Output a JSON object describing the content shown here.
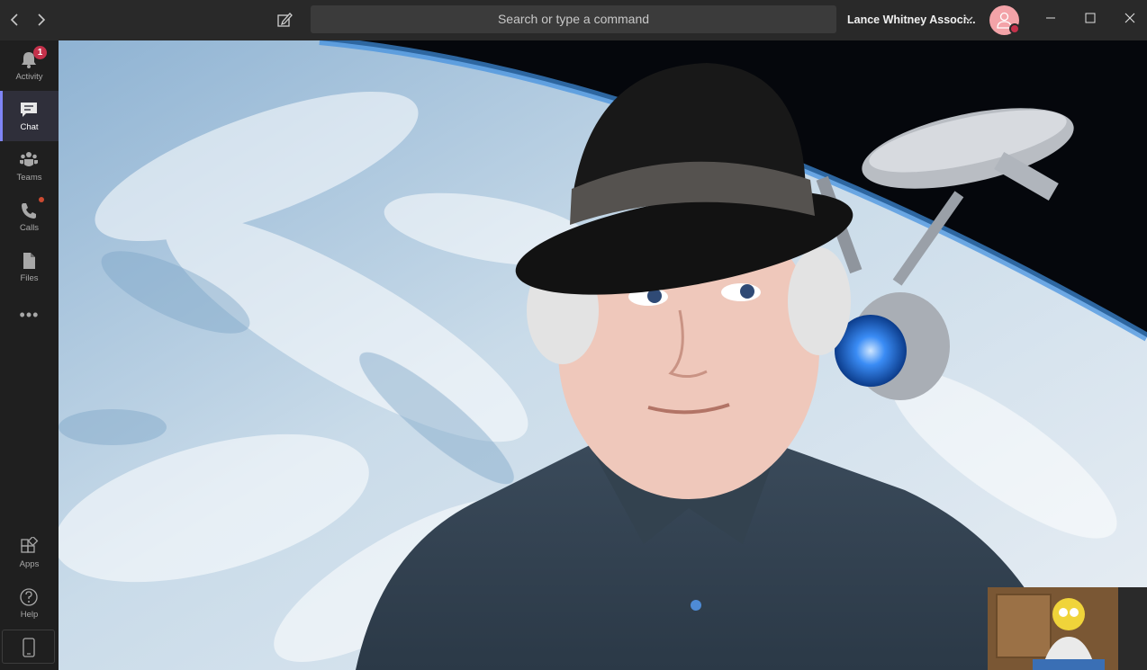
{
  "titlebar": {
    "search_placeholder": "Search or type a command",
    "org_name": "Lance Whitney Associ...",
    "back_icon": "chevron-left-icon",
    "forward_icon": "chevron-right-icon",
    "compose_icon": "compose-icon",
    "minimize_icon": "minimize-icon",
    "maximize_icon": "maximize-icon",
    "close_icon": "close-icon"
  },
  "rail": {
    "items": [
      {
        "label": "Activity",
        "icon": "bell-icon",
        "badge": "1"
      },
      {
        "label": "Chat",
        "icon": "chat-icon",
        "active": true
      },
      {
        "label": "Teams",
        "icon": "teams-icon"
      },
      {
        "label": "Calls",
        "icon": "phone-icon",
        "dot": true
      },
      {
        "label": "Files",
        "icon": "files-icon"
      }
    ],
    "more_label": "•••",
    "bottom_items": [
      {
        "label": "Apps",
        "icon": "apps-icon"
      },
      {
        "label": "Help",
        "icon": "help-icon"
      }
    ]
  },
  "colors": {
    "accent": "#7f85f5",
    "badge": "#c4314b",
    "titlebar_bg": "#292929",
    "rail_bg": "#1f1f1f"
  }
}
